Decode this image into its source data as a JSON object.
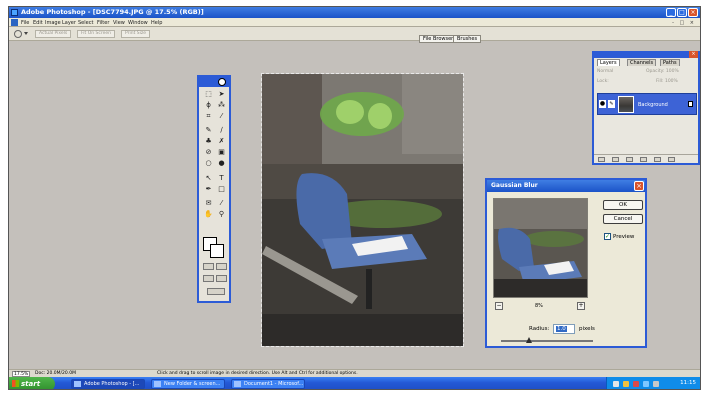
{
  "window": {
    "title": "Adobe Photoshop - [DSC7794.JPG @ 17.5% (RGB)]",
    "controls": [
      "_",
      "□",
      "×"
    ]
  },
  "menubar": {
    "items": [
      "File",
      "Edit",
      "Image",
      "Layer",
      "Select",
      "Filter",
      "View",
      "Window",
      "Help"
    ],
    "doc_controls": "- □ ×"
  },
  "optionsbar": {
    "buttons": [
      "Actual Pixels",
      "Fit On Screen",
      "Print Size"
    ]
  },
  "palette_well": {
    "tabs": [
      "File Browser",
      "Brushes"
    ]
  },
  "layers_panel": {
    "tabs": [
      "Layers",
      "Channels",
      "Paths"
    ],
    "blend_mode": "Normal",
    "opacity": "Opacity: 100%",
    "lock_label": "Lock:",
    "fill": "Fill: 100%",
    "layer_name": "Background"
  },
  "dialog": {
    "title": "Gaussian Blur",
    "ok_label": "OK",
    "cancel_label": "Cancel",
    "preview_label": "Preview",
    "preview_checked": true,
    "zoom_out": "−",
    "zoom_in": "+",
    "zoom_level": "8%",
    "radius_label": "Radius:",
    "radius_value": "1.0",
    "radius_unit": "pixels",
    "radius_slider_fraction": 0.3
  },
  "statusbar": {
    "zoom": "17.5%",
    "doc_info": "Doc: 20.0M/20.0M",
    "hint": "Click and drag to scroll image in desired direction. Use Alt and Ctrl for additional options."
  },
  "taskbar": {
    "start_label": "start",
    "tasks": [
      "Adobe Photoshop - [...",
      "New Folder & screen...",
      "Document1 - Microsof..."
    ],
    "clock": "11:15"
  },
  "colors": {
    "xp_blue": "#2c5bd6",
    "desktop_gray": "#c4c0bb",
    "start_green": "#3a9a36"
  }
}
